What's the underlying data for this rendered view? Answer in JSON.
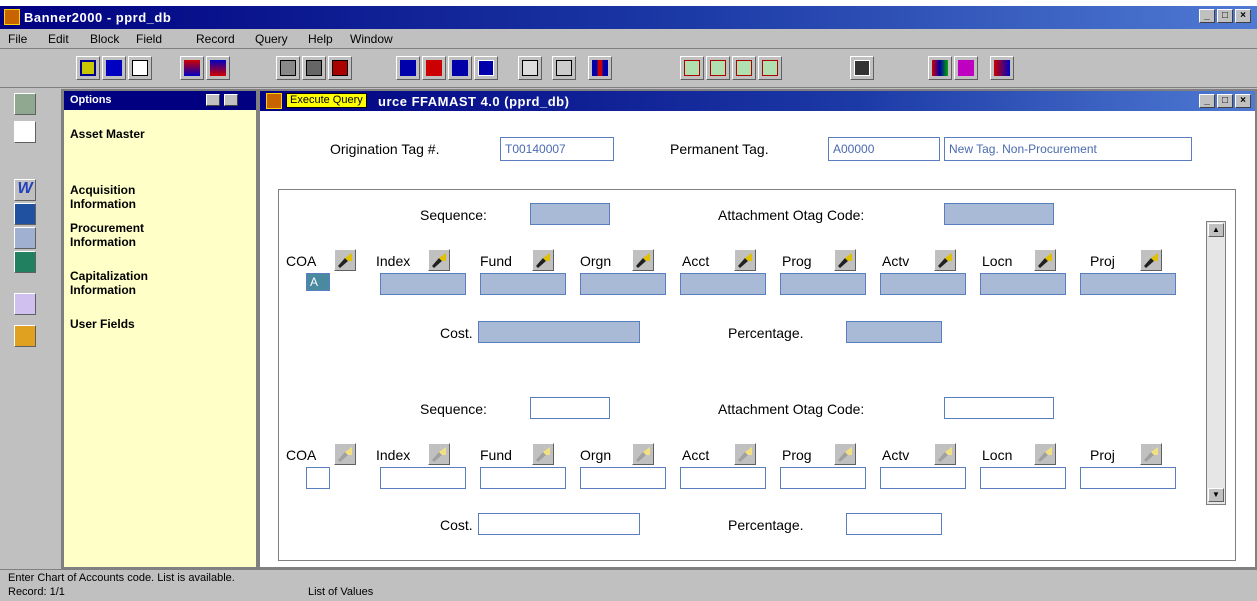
{
  "window": {
    "title": "Banner2000 - pprd_db"
  },
  "menu": [
    "File",
    "Edit",
    "Block",
    "Field",
    "Record",
    "Query",
    "Help",
    "Window"
  ],
  "toolbar": {
    "icons": [
      "save-icon",
      "rollback-icon",
      "exit-icon",
      "previous-block-icon",
      "next-block-icon",
      "enter-query-icon",
      "execute-query-icon",
      "cancel-query-icon",
      "previous-record-icon",
      "next-record-icon",
      "insert-record-icon",
      "delete-record-icon",
      "clear-record-icon",
      "print-icon",
      "chart-icon",
      "help-icon-1",
      "help-icon-2",
      "help-icon-3",
      "help-icon-4",
      "window-icon",
      "forms-icon",
      "exit-door-icon"
    ]
  },
  "options": {
    "header": "Options",
    "items": [
      "Asset Master",
      "Acquisition Information",
      "Procurement Information",
      "Capitalization Information",
      "User Fields"
    ]
  },
  "form": {
    "tooltip": "Execute Query",
    "title_rest": "urce  FFAMAST  4.0  (pprd_db)",
    "origination_label": "Origination Tag #.",
    "origination_value": "T00140007",
    "permanent_label": "Permanent Tag.",
    "permanent_value": "A00000",
    "permanent_desc": "New Tag. Non-Procurement",
    "rec1": {
      "sequence_label": "Sequence:",
      "attach_label": "Attachment Otag Code:",
      "coa_label": "COA",
      "coa_value": "A",
      "index_label": "Index",
      "fund_label": "Fund",
      "orgn_label": "Orgn",
      "acct_label": "Acct",
      "prog_label": "Prog",
      "actv_label": "Actv",
      "locn_label": "Locn",
      "proj_label": "Proj",
      "cost_label": "Cost.",
      "percentage_label": "Percentage."
    },
    "rec2": {
      "sequence_label": "Sequence:",
      "attach_label": "Attachment Otag Code:",
      "coa_label": "COA",
      "index_label": "Index",
      "fund_label": "Fund",
      "orgn_label": "Orgn",
      "acct_label": "Acct",
      "prog_label": "Prog",
      "actv_label": "Actv",
      "locn_label": "Locn",
      "proj_label": "Proj",
      "cost_label": "Cost.",
      "percentage_label": "Percentage."
    }
  },
  "status": {
    "hint": "Enter Chart of Accounts code. List is available.",
    "record": "Record: 1/1",
    "lov": "List of Values"
  }
}
